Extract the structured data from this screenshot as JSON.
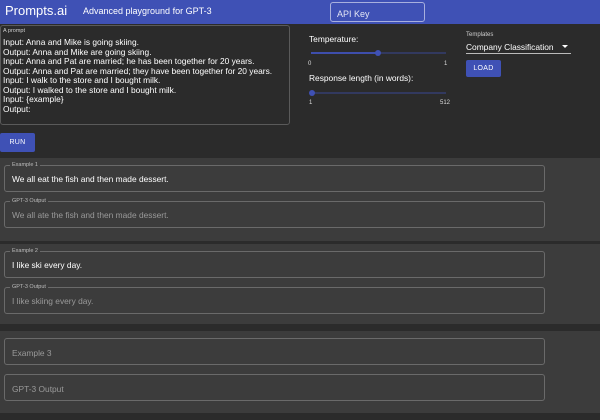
{
  "header": {
    "brand": "Prompts.ai",
    "tagline": "Advanced playground for GPT-3",
    "api_key_placeholder": "API Key",
    "bg_color": "#3f51b5"
  },
  "prompt": {
    "label": "A prompt",
    "text": "Input: Anna and Mike is going skiing.\nOutput: Anna and Mike are going skiing.\nInput: Anna and Pat are married; he has been together for 20 years.\nOutput: Anna and Pat are married; they have been together for 20 years.\nInput: I walk to the store and I bought milk.\nOutput: I walked to the store and I bought milk.\nInput: {example}\nOutput:"
  },
  "controls": {
    "temperature": {
      "label": "Temperature:",
      "min": "0",
      "max": "1",
      "value": 0.5
    },
    "length": {
      "label": "Response length (in words):",
      "min": "1",
      "max": "512",
      "value": 1
    },
    "templates": {
      "label": "Templates",
      "selected": "Company Classification"
    },
    "load_label": "LOAD",
    "run_label": "RUN"
  },
  "examples": [
    {
      "label": "Example 1",
      "input": "We all eat the fish and then made dessert.",
      "output_label": "GPT-3 Output",
      "output": "We all ate the fish and then made dessert."
    },
    {
      "label": "Example 2",
      "input": "I like ski every day.",
      "output_label": "GPT-3 Output",
      "output": "I like skiing every day."
    },
    {
      "label": "Example 3",
      "input": "",
      "output_label": "GPT-3 Output",
      "output": ""
    }
  ]
}
